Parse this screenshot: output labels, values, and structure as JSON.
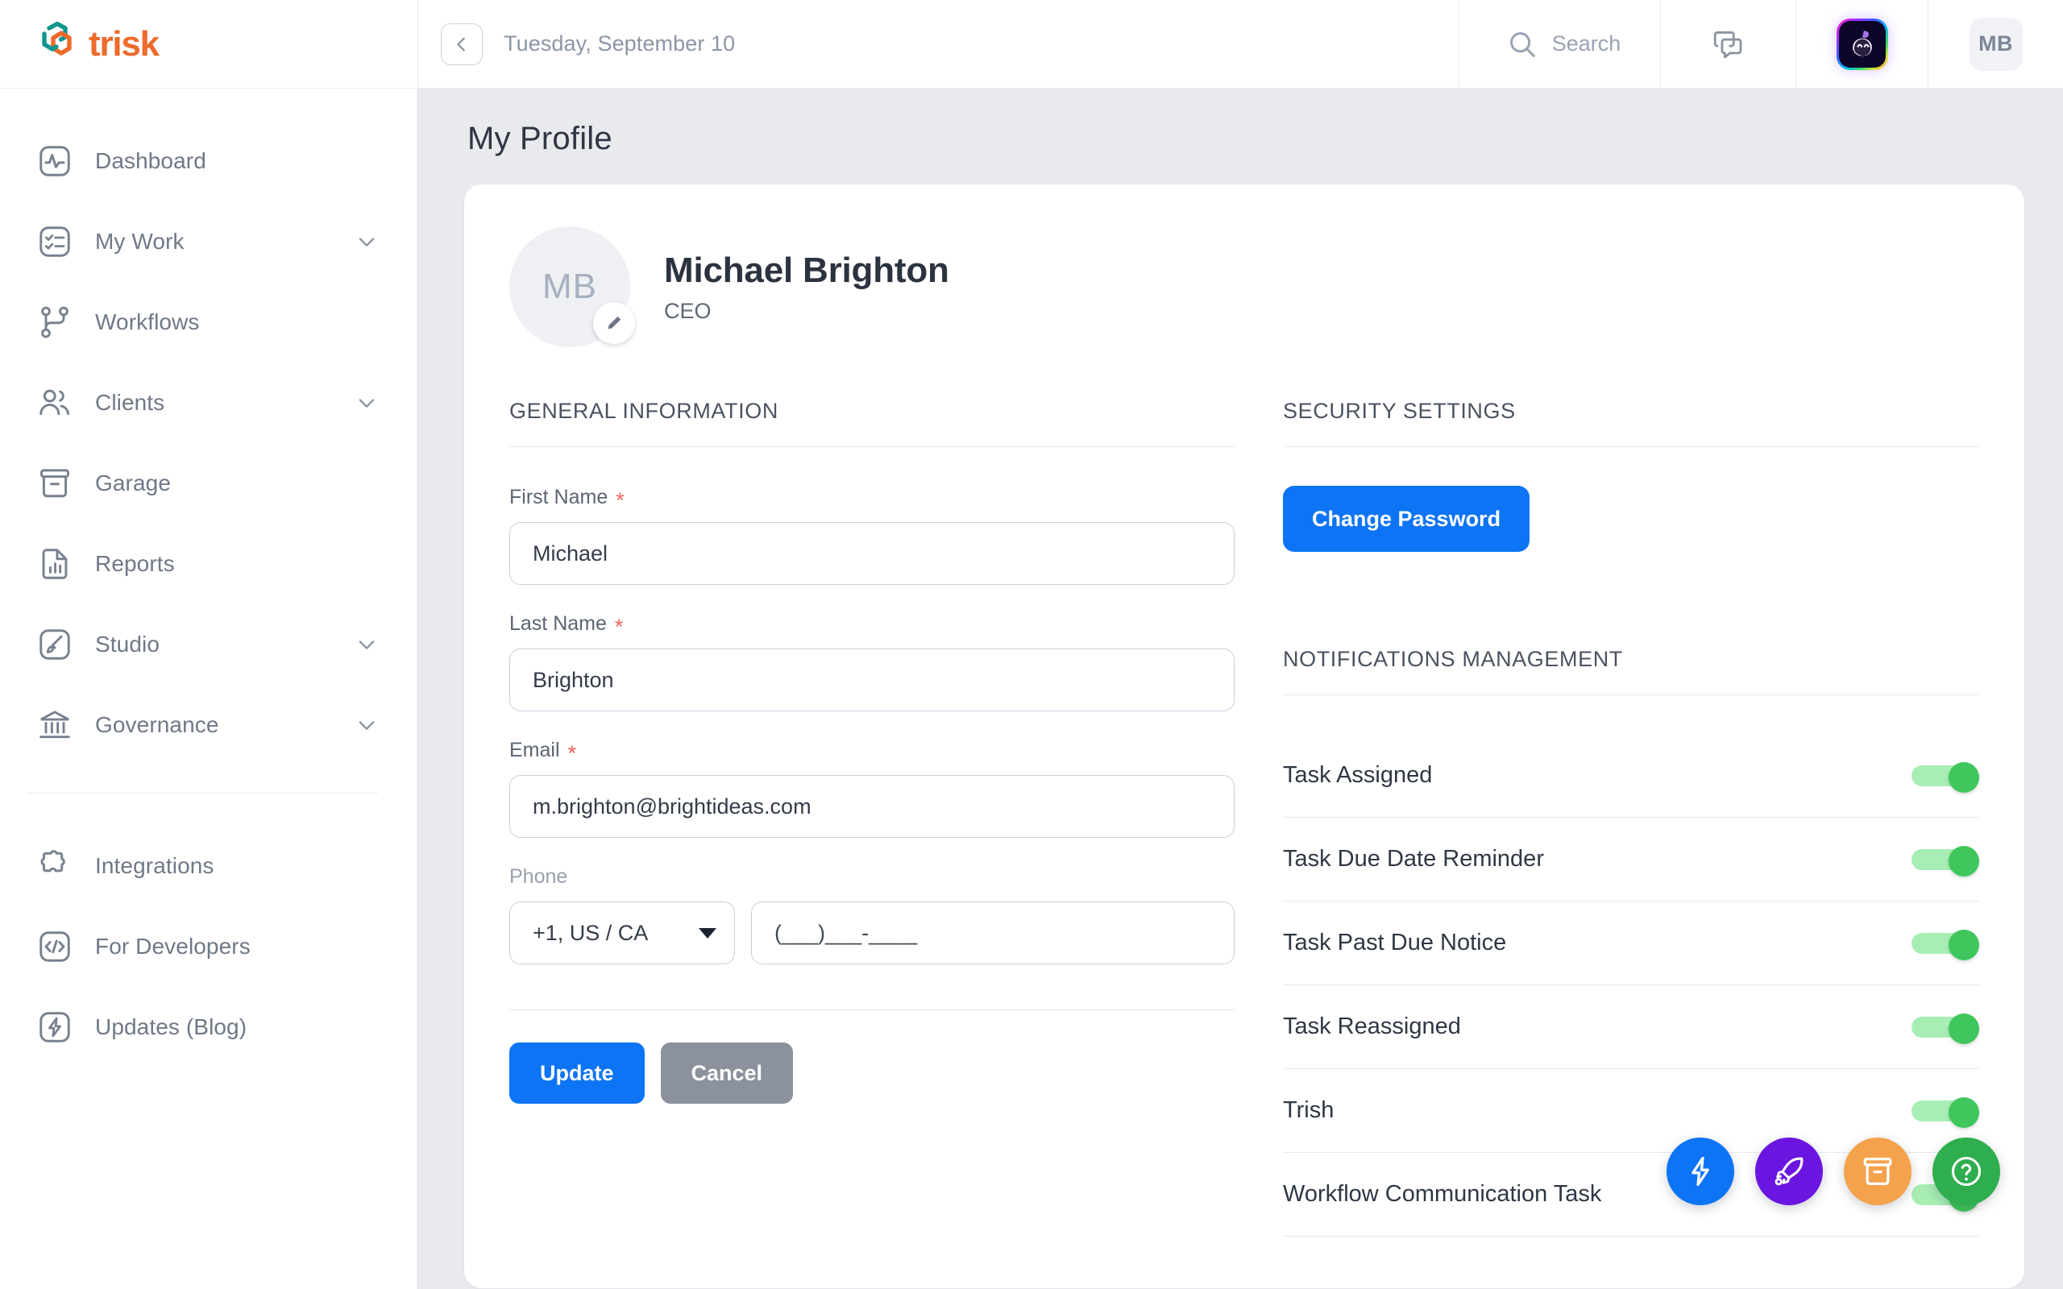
{
  "brand": {
    "name": "trisk",
    "logo_icon": "trisk-hexagon-logo"
  },
  "topbar": {
    "collapse_icon": "chevron-left-icon",
    "date": "Tuesday, September 10",
    "search": {
      "icon": "search-icon",
      "placeholder": "Search"
    },
    "chat": {
      "icon": "chat-bubbles-icon"
    },
    "assistant": {
      "icon": "ai-assistant-avatar-icon"
    },
    "avatar": {
      "initials": "MB"
    }
  },
  "sidebar": {
    "items": [
      {
        "label": "Dashboard",
        "icon": "activity-pulse-icon",
        "expandable": false
      },
      {
        "label": "My Work",
        "icon": "checklist-icon",
        "expandable": true
      },
      {
        "label": "Workflows",
        "icon": "workflow-branch-icon",
        "expandable": false
      },
      {
        "label": "Clients",
        "icon": "users-icon",
        "expandable": true
      },
      {
        "label": "Garage",
        "icon": "archive-box-icon",
        "expandable": false
      },
      {
        "label": "Reports",
        "icon": "document-chart-icon",
        "expandable": false
      },
      {
        "label": "Studio",
        "icon": "paintbrush-icon",
        "expandable": true
      },
      {
        "label": "Governance",
        "icon": "bank-columns-icon",
        "expandable": true
      }
    ],
    "secondary_items": [
      {
        "label": "Integrations",
        "icon": "puzzle-piece-icon"
      },
      {
        "label": "For Developers",
        "icon": "code-brackets-icon"
      },
      {
        "label": "Updates (Blog)",
        "icon": "lightning-bolt-icon"
      }
    ]
  },
  "main": {
    "page_title": "My Profile",
    "profile": {
      "avatar_initials": "MB",
      "edit_icon": "pencil-icon",
      "name": "Michael Brighton",
      "role": "CEO"
    },
    "general_information": {
      "section_title": "GENERAL INFORMATION",
      "fields": {
        "first_name": {
          "label": "First Name",
          "required": "*",
          "value": "Michael"
        },
        "last_name": {
          "label": "Last Name",
          "required": "*",
          "value": "Brighton"
        },
        "email": {
          "label": "Email",
          "required": "*",
          "value": "m.brighton@brightideas.com"
        },
        "phone": {
          "label": "Phone",
          "country_code": "+1, US / CA",
          "placeholder": "(___)___-____",
          "value": ""
        }
      },
      "buttons": {
        "update": "Update",
        "cancel": "Cancel"
      }
    },
    "security_settings": {
      "section_title": "SECURITY SETTINGS",
      "change_password": "Change Password"
    },
    "notifications_management": {
      "section_title": "NOTIFICATIONS MANAGEMENT",
      "rows": [
        {
          "label": "Task Assigned",
          "enabled": true
        },
        {
          "label": "Task Due Date Reminder",
          "enabled": true
        },
        {
          "label": "Task Past Due Notice",
          "enabled": true
        },
        {
          "label": "Task Reassigned",
          "enabled": true
        },
        {
          "label": "Trish",
          "enabled": true
        },
        {
          "label": "Workflow Communication Task",
          "enabled": true
        }
      ]
    }
  },
  "fabs": [
    {
      "icon": "lightning-bolt-icon",
      "color": "#0d74f5"
    },
    {
      "icon": "rocket-icon",
      "color": "#6a16e0"
    },
    {
      "icon": "archive-box-icon",
      "color": "#f5a24d"
    },
    {
      "icon": "question-mark-circle-icon",
      "color": "#2eae4e"
    }
  ],
  "colors": {
    "brand_orange": "#ee6a2b",
    "brand_teal": "#11958f",
    "primary_blue": "#0d74f5",
    "toggle_green": "#3fc65c",
    "required_red": "#f2645a",
    "page_bg": "#e8eaee"
  }
}
